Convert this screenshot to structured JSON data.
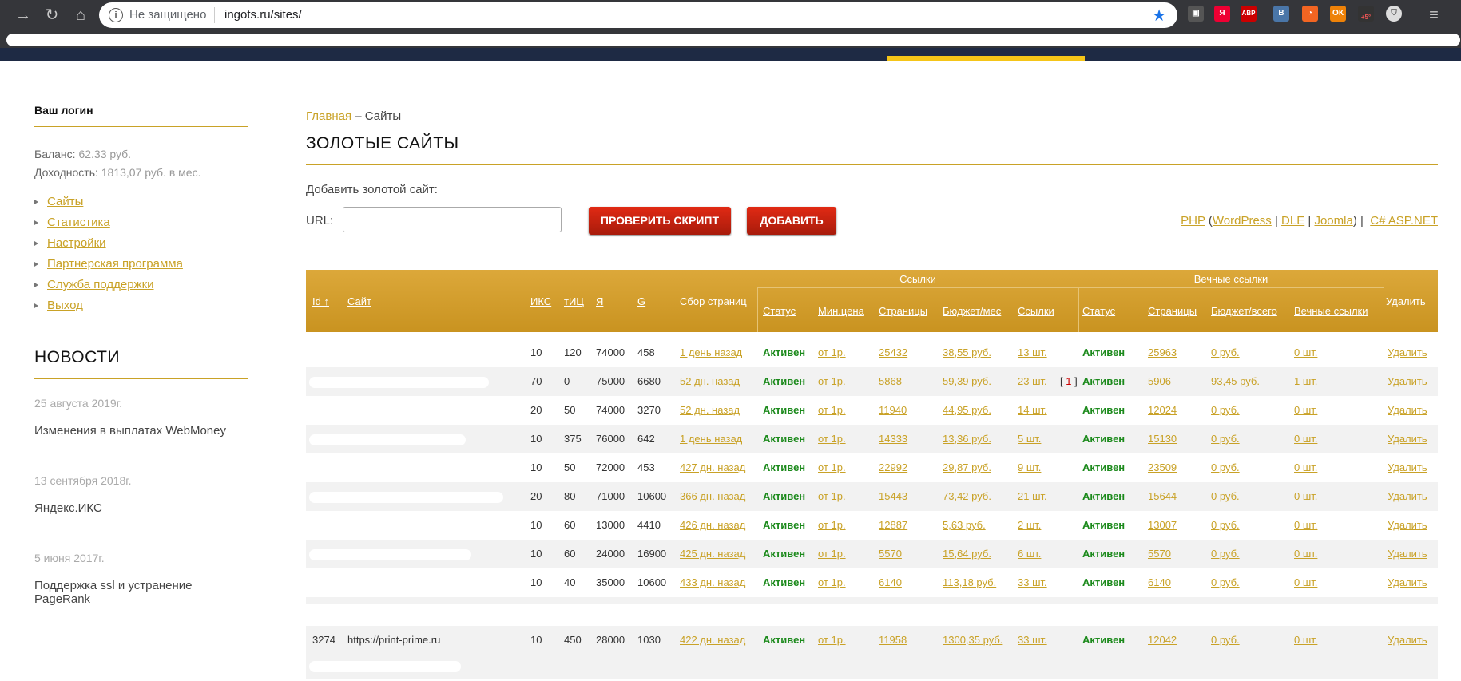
{
  "browser": {
    "security": "Не защищено",
    "url": "ingots.ru/sites/",
    "extensions": [
      "abp-icon",
      "vk-icon",
      "rss-icon",
      "ok-icon",
      "weather-icon"
    ],
    "weather_badge": "+5°",
    "abp_label": "ABP",
    "vk_label": "B"
  },
  "sidebar": {
    "login_label": "Ваш логин",
    "balance_label": "Баланс:",
    "balance_value": "62.33 руб.",
    "income_label": "Доходность:",
    "income_value": "1813,07 руб. в мес.",
    "menu": [
      "Сайты",
      "Статистика",
      "Настройки",
      "Партнерская программа",
      "Служба поддержки",
      "Выход"
    ],
    "news_title": "НОВОСТИ",
    "news": [
      {
        "date": "25 августа 2019г.",
        "text": "Изменения в выплатах WebMoney"
      },
      {
        "date": "13 сентября 2018г.",
        "text": "Яндекс.ИКС"
      },
      {
        "date": "5 июня 2017г.",
        "text": "Поддержка ssl и устранение PageRank"
      }
    ]
  },
  "main": {
    "breadcrumb_home": "Главная",
    "breadcrumb_sep": " – ",
    "breadcrumb_current": "Сайты",
    "title": "ЗОЛОТЫЕ САЙТЫ",
    "add_label": "Добавить золотой сайт:",
    "url_label": "URL:",
    "url_value": "",
    "check_button": "ПРОВЕРИТЬ СКРИПТ",
    "add_button": "ДОБАВИТЬ",
    "platforms": {
      "php": "PHP",
      "wordpress": "WordPress",
      "dle": "DLE",
      "joomla": "Joomla",
      "asp": "C# ASP.NET"
    }
  },
  "table": {
    "group_links": "Ссылки",
    "group_eternal": "Вечные ссылки",
    "headers": {
      "id": "Id ↑",
      "site": "Сайт",
      "iks": "ИКС",
      "tic": "тИЦ",
      "ya": "Я",
      "g": "G",
      "collect": "Сбор страниц",
      "status": "Статус",
      "min_price": "Мин.цена",
      "pages": "Страницы",
      "budget": "Бюджет/мес",
      "links": "Ссылки",
      "e_status": "Статус",
      "e_pages": "Страницы",
      "e_budget": "Бюджет/всего",
      "e_links": "Вечные ссылки",
      "delete": "Удалить"
    },
    "rows": [
      {
        "id": "",
        "site": "",
        "iks": "10",
        "tic": "120",
        "ya": "74000",
        "g": "458",
        "collect": "1 день назад",
        "status": "Активен",
        "min": "от 1р.",
        "pages": "25432",
        "budget": "38,55 руб.",
        "links": "13 шт.",
        "extra": "",
        "e_status": "Активен",
        "e_pages": "25963",
        "e_budget": "0 руб.",
        "e_links": "0 шт.",
        "del": "Удалить"
      },
      {
        "id": "",
        "site": "",
        "iks": "70",
        "tic": "0",
        "ya": "75000",
        "g": "6680",
        "collect": "52 дн. назад",
        "status": "Активен",
        "min": "от 1р.",
        "pages": "5868",
        "budget": "59,39 руб.",
        "links": "23 шт.",
        "extra": "1",
        "e_status": "Активен",
        "e_pages": "5906",
        "e_budget": "93,45 руб.",
        "e_links": "1 шт.",
        "del": "Удалить"
      },
      {
        "id": "",
        "site": "",
        "iks": "20",
        "tic": "50",
        "ya": "74000",
        "g": "3270",
        "collect": "52 дн. назад",
        "status": "Активен",
        "min": "от 1р.",
        "pages": "11940",
        "budget": "44,95 руб.",
        "links": "14 шт.",
        "extra": "",
        "e_status": "Активен",
        "e_pages": "12024",
        "e_budget": "0 руб.",
        "e_links": "0 шт.",
        "del": "Удалить"
      },
      {
        "id": "",
        "site": "",
        "iks": "10",
        "tic": "375",
        "ya": "76000",
        "g": "642",
        "collect": "1 день назад",
        "status": "Активен",
        "min": "от 1р.",
        "pages": "14333",
        "budget": "13,36 руб.",
        "links": "5 шт.",
        "extra": "",
        "e_status": "Активен",
        "e_pages": "15130",
        "e_budget": "0 руб.",
        "e_links": "0 шт.",
        "del": "Удалить"
      },
      {
        "id": "",
        "site": "",
        "iks": "10",
        "tic": "50",
        "ya": "72000",
        "g": "453",
        "collect": "427 дн. назад",
        "status": "Активен",
        "min": "от 1р.",
        "pages": "22992",
        "budget": "29,87 руб.",
        "links": "9 шт.",
        "extra": "",
        "e_status": "Активен",
        "e_pages": "23509",
        "e_budget": "0 руб.",
        "e_links": "0 шт.",
        "del": "Удалить"
      },
      {
        "id": "",
        "site": "",
        "iks": "20",
        "tic": "80",
        "ya": "71000",
        "g": "10600",
        "collect": "366 дн. назад",
        "status": "Активен",
        "min": "от 1р.",
        "pages": "15443",
        "budget": "73,42 руб.",
        "links": "21 шт.",
        "extra": "",
        "e_status": "Активен",
        "e_pages": "15644",
        "e_budget": "0 руб.",
        "e_links": "0 шт.",
        "del": "Удалить"
      },
      {
        "id": "",
        "site": "",
        "iks": "10",
        "tic": "60",
        "ya": "13000",
        "g": "4410",
        "collect": "426 дн. назад",
        "status": "Активен",
        "min": "от 1р.",
        "pages": "12887",
        "budget": "5,63 руб.",
        "links": "2 шт.",
        "extra": "",
        "e_status": "Активен",
        "e_pages": "13007",
        "e_budget": "0 руб.",
        "e_links": "0 шт.",
        "del": "Удалить"
      },
      {
        "id": "",
        "site": "",
        "iks": "10",
        "tic": "60",
        "ya": "24000",
        "g": "16900",
        "collect": "425 дн. назад",
        "status": "Активен",
        "min": "от 1р.",
        "pages": "5570",
        "budget": "15,64 руб.",
        "links": "6 шт.",
        "extra": "",
        "e_status": "Активен",
        "e_pages": "5570",
        "e_budget": "0 руб.",
        "e_links": "0 шт.",
        "del": "Удалить"
      },
      {
        "id": "",
        "site": "",
        "iks": "10",
        "tic": "40",
        "ya": "35000",
        "g": "10600",
        "collect": "433 дн. назад",
        "status": "Активен",
        "min": "от 1р.",
        "pages": "6140",
        "budget": "113,18 руб.",
        "links": "33 шт.",
        "extra": "",
        "e_status": "Активен",
        "e_pages": "6140",
        "e_budget": "0 руб.",
        "e_links": "0 шт.",
        "del": "Удалить"
      },
      {
        "id": "3274",
        "site": "https://print-prime.ru",
        "iks": "10",
        "tic": "450",
        "ya": "28000",
        "g": "1030",
        "collect": "422 дн. назад",
        "status": "Активен",
        "min": "от 1р.",
        "pages": "11958",
        "budget": "1300,35 руб.",
        "links": "33 шт.",
        "extra": "",
        "e_status": "Активен",
        "e_pages": "12042",
        "e_budget": "0 руб.",
        "e_links": "0 шт.",
        "del": "Удалить"
      }
    ]
  }
}
